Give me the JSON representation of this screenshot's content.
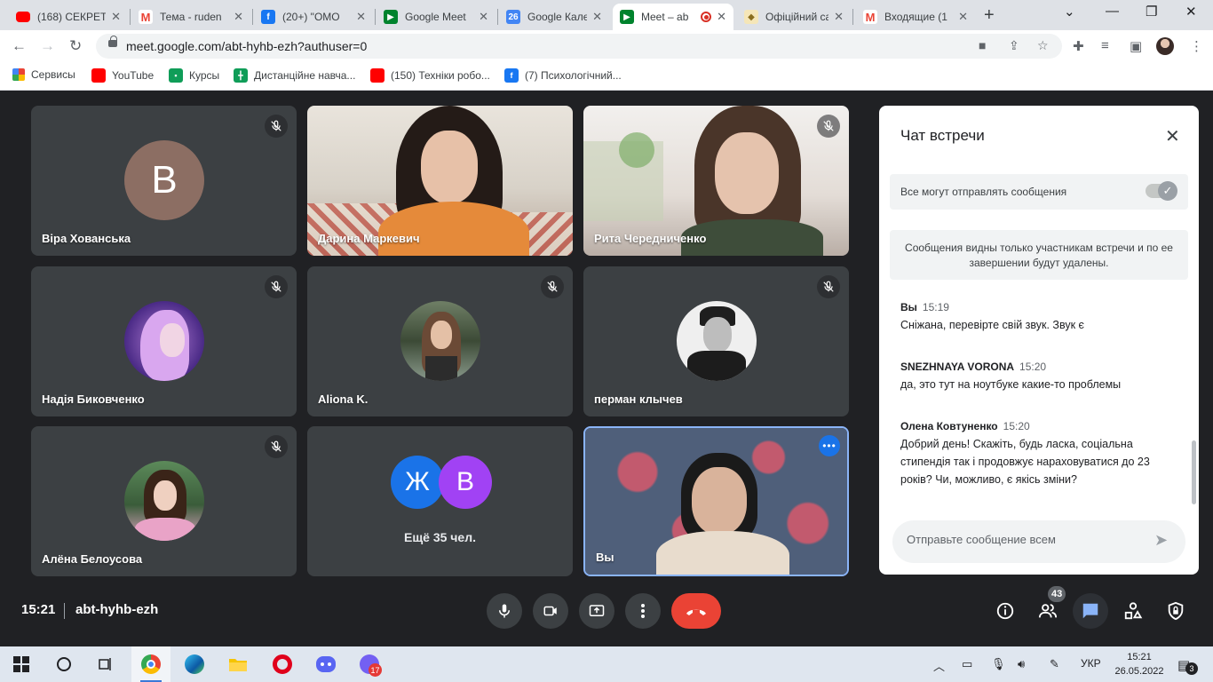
{
  "browser": {
    "tabs": [
      {
        "label": "(168) СЕКРЕТ",
        "favicon": "youtube-icon",
        "color": "#ff0000"
      },
      {
        "label": "Тема - ruden",
        "favicon": "gmail-icon",
        "color": "#ea4335"
      },
      {
        "label": "(20+) \"ОМО",
        "favicon": "facebook-icon",
        "color": "#1877f2"
      },
      {
        "label": "Google Meet",
        "favicon": "meet-icon",
        "color": "#00832d"
      },
      {
        "label": "Google Кален",
        "favicon": "calendar-icon",
        "color": "#4285f4",
        "favicon_text": "26"
      },
      {
        "label": "Meet – ab",
        "favicon": "meet-icon",
        "color": "#00832d",
        "active": true
      },
      {
        "label": "Офіційний са",
        "favicon": "site-icon",
        "color": "#d4a017"
      },
      {
        "label": "Входящие (1",
        "favicon": "gmail-icon",
        "color": "#ea4335"
      }
    ],
    "url": "meet.google.com/abt-hyhb-ezh?authuser=0",
    "bookmarks": [
      {
        "label": "Сервисы",
        "icon": "apps-grid-icon"
      },
      {
        "label": "YouTube",
        "icon": "youtube-icon"
      },
      {
        "label": "Курсы",
        "icon": "classroom-icon"
      },
      {
        "label": "Дистанційне навча...",
        "icon": "sheets-icon"
      },
      {
        "label": "(150) Техніки робо...",
        "icon": "youtube-icon"
      },
      {
        "label": "(7) Психологічний...",
        "icon": "facebook-icon"
      }
    ]
  },
  "meeting": {
    "tiles": [
      {
        "name": "Віра Хованська",
        "initial": "В",
        "muted": true
      },
      {
        "name": "Дарина Маркевич",
        "muted": false
      },
      {
        "name": "Рита Чередниченко",
        "muted": true
      },
      {
        "name": "Надія Биковченко",
        "muted": true
      },
      {
        "name": "Aliona K.",
        "muted": true
      },
      {
        "name": "перман клычев",
        "muted": true
      },
      {
        "name": "Алёна Белоусова",
        "muted": true
      },
      {
        "name": "Ещё 35 чел.",
        "initials": [
          "Ж",
          "В"
        ]
      },
      {
        "name": "Вы",
        "self": true
      }
    ],
    "time": "15:21",
    "code": "abt-hyhb-ezh",
    "participants_count": "43"
  },
  "chat": {
    "title": "Чат встречи",
    "permission_label": "Все могут отправлять сообщения",
    "notice": "Сообщения видны только участникам встречи и по ее завершении будут удалены.",
    "messages": [
      {
        "sender": "Вы",
        "time": "15:19",
        "text": "Сніжана, перевірте свій звук. Звук є"
      },
      {
        "sender": "SNEZHNAYA VORONA",
        "time": "15:20",
        "text": "да, это тут на ноутбуке какие-то проблемы"
      },
      {
        "sender": "Олена Ковтуненко",
        "time": "15:20",
        "text": "Добрий день! Скажіть, будь ласка, соціальна стипендія так і продовжує нараховуватися до 23 років? Чи, можливо, є якісь зміни?"
      }
    ],
    "input_placeholder": "Отправьте сообщение всем"
  },
  "taskbar": {
    "lang": "УКР",
    "time": "15:21",
    "date": "26.05.2022",
    "notifications": "3",
    "viber_badge": "17"
  }
}
